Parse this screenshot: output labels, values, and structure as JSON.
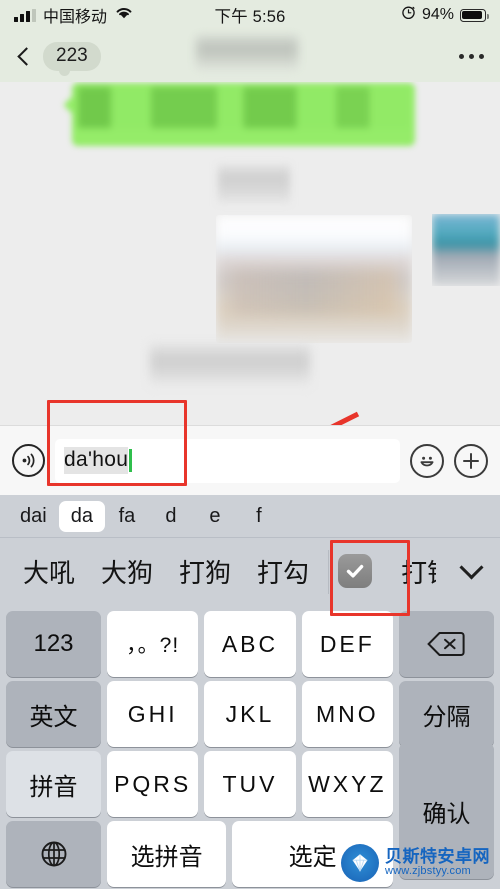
{
  "status_bar": {
    "carrier": "中国移动",
    "time": "下午 5:56",
    "battery_percent": "94%",
    "signal_icon": "signal-bars-icon",
    "wifi_icon": "wifi-icon",
    "alarm_icon": "alarm-clock-icon",
    "battery_icon": "battery-icon"
  },
  "nav_bar": {
    "back_icon": "chevron-left-icon",
    "back_badge": "223",
    "title": "",
    "more_icon": "more-dots-icon"
  },
  "chat": {
    "messages": [
      {
        "type": "text-bubble",
        "side": "right",
        "color": "#95ec69",
        "content": ""
      },
      {
        "type": "text-blurred",
        "side": "center",
        "content": ""
      },
      {
        "type": "image",
        "side": "right",
        "content": ""
      },
      {
        "type": "image-thumb",
        "side": "right",
        "content": ""
      },
      {
        "type": "text-blurred",
        "side": "left",
        "content": ""
      }
    ]
  },
  "input_bar": {
    "voice_icon": "voice-wave-icon",
    "compose_text": "da'hou",
    "placeholder": "",
    "emoji_icon": "smiley-icon",
    "plus_icon": "plus-circle-icon"
  },
  "keyboard": {
    "pinyin_options": [
      {
        "label": "dai",
        "active": false
      },
      {
        "label": "da",
        "active": true
      },
      {
        "label": "fa",
        "active": false
      },
      {
        "label": "d",
        "active": false
      },
      {
        "label": "e",
        "active": false
      },
      {
        "label": "f",
        "active": false
      }
    ],
    "candidates": [
      {
        "label": "大吼",
        "type": "text"
      },
      {
        "label": "大狗",
        "type": "text"
      },
      {
        "label": "打狗",
        "type": "text"
      },
      {
        "label": "打勾",
        "type": "text"
      },
      {
        "label": "✔",
        "type": "emoji-check"
      },
      {
        "label": "打钩",
        "type": "text-cut"
      }
    ],
    "expand_icon": "chevron-down-icon",
    "rows": [
      [
        {
          "label": "123",
          "style": "gray"
        },
        {
          "label": "，。?!",
          "style": "white"
        },
        {
          "label": "ABC",
          "style": "white"
        },
        {
          "label": "DEF",
          "style": "white"
        },
        {
          "label": "backspace-icon",
          "style": "gray"
        }
      ],
      [
        {
          "label": "英文",
          "style": "gray"
        },
        {
          "label": "GHI",
          "style": "white"
        },
        {
          "label": "JKL",
          "style": "white"
        },
        {
          "label": "MNO",
          "style": "white"
        },
        {
          "label": "分隔",
          "style": "gray"
        }
      ],
      [
        {
          "label": "拼音",
          "style": "light"
        },
        {
          "label": "PQRS",
          "style": "white"
        },
        {
          "label": "TUV",
          "style": "white"
        },
        {
          "label": "WXYZ",
          "style": "white"
        }
      ],
      [
        {
          "label": "globe-icon",
          "style": "gray"
        },
        {
          "label": "选拼音",
          "style": "white"
        },
        {
          "label": "选定",
          "style": "white"
        }
      ]
    ],
    "confirm_key": "确认"
  },
  "annotations": {
    "box_input_label": "highlight-input-box",
    "box_candidate_label": "highlight-checkmark-candidate",
    "arrow_label": "red-arrow-pointing-to-input",
    "color": "#e8352b"
  },
  "watermark": {
    "title": "贝斯特安卓网",
    "url": "www.zjbstyy.com"
  }
}
